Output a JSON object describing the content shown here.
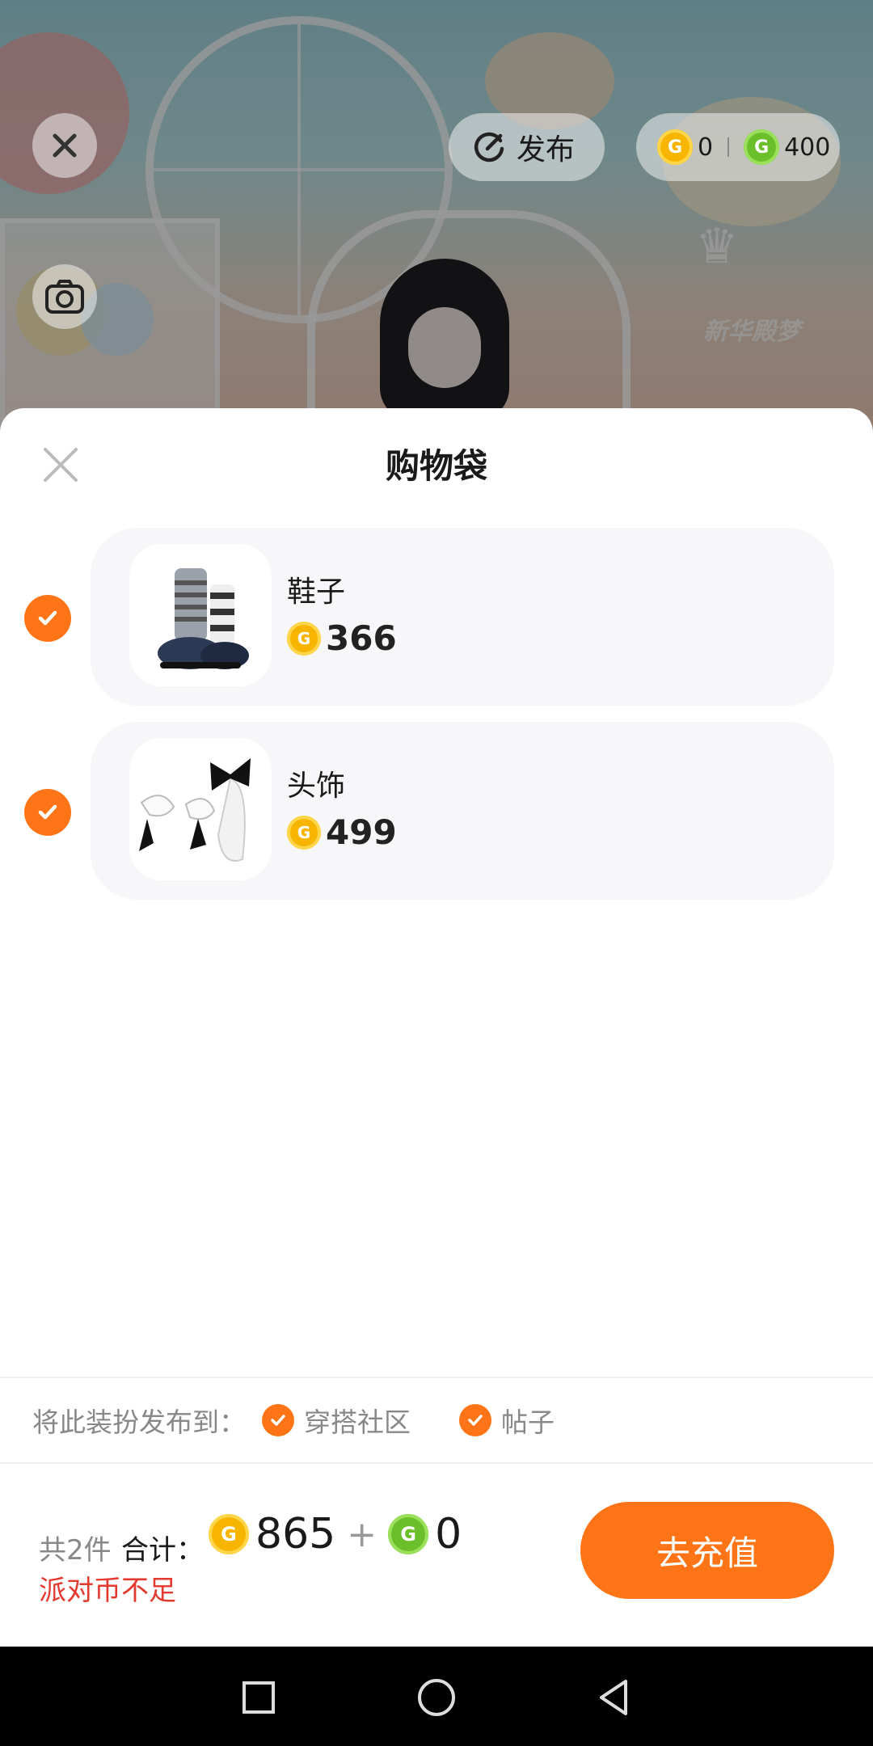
{
  "top_bar": {
    "publish_label": "发布",
    "gold_balance": "0",
    "green_balance": "400",
    "brand_watermark": "新华殿梦"
  },
  "sheet": {
    "title": "购物袋",
    "items": [
      {
        "name": "鞋子",
        "price": "366",
        "coin": "gold",
        "selected": true
      },
      {
        "name": "头饰",
        "price": "499",
        "coin": "gold",
        "selected": true
      }
    ]
  },
  "publish": {
    "label": "将此装扮发布到：",
    "options": [
      {
        "label": "穿搭社区",
        "checked": true
      },
      {
        "label": "帖子",
        "checked": true
      }
    ]
  },
  "summary": {
    "count_text": "共2件",
    "total_label": "合计：",
    "gold_total": "865",
    "plus": "+",
    "green_total": "0",
    "warning": "派对币不足",
    "recharge_label": "去充值"
  },
  "colors": {
    "accent": "#ff7417",
    "warning": "#e4392f",
    "gold_coin": "#f7b500",
    "green_coin": "#6bbf2a"
  }
}
